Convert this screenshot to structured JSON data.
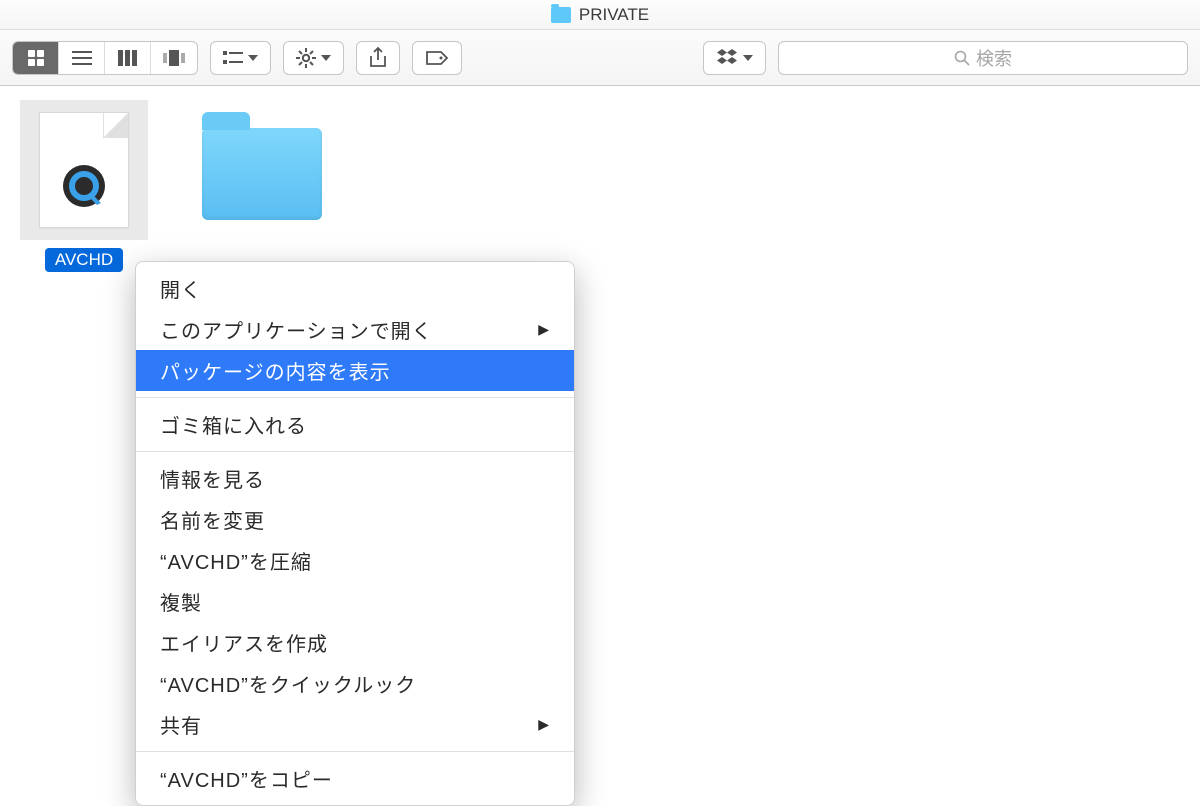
{
  "window": {
    "title": "PRIVATE"
  },
  "toolbar": {
    "search_placeholder": "検索"
  },
  "files": {
    "selected": {
      "name": "AVCHD"
    }
  },
  "context_menu": {
    "open": "開く",
    "open_with": "このアプリケーションで開く",
    "show_package": "パッケージの内容を表示",
    "trash": "ゴミ箱に入れる",
    "get_info": "情報を見る",
    "rename": "名前を変更",
    "compress": "“AVCHD”を圧縮",
    "duplicate": "複製",
    "alias": "エイリアスを作成",
    "quicklook": "“AVCHD”をクイックルック",
    "share": "共有",
    "copy": "“AVCHD”をコピー"
  }
}
